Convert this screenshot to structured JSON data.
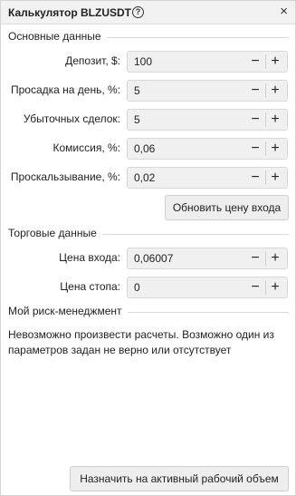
{
  "window": {
    "title": "Калькулятор BLZUSDT",
    "help_glyph": "?",
    "close_glyph": "×"
  },
  "sections": {
    "main": "Основные данные",
    "trade": "Торговые данные",
    "risk": "Мой риск-менеджмент"
  },
  "fields": {
    "deposit": {
      "label": "Депозит, $:",
      "value": "100"
    },
    "drawdown": {
      "label": "Просадка на день, %:",
      "value": "5"
    },
    "losing_trades": {
      "label": "Убыточных сделок:",
      "value": "5"
    },
    "commission": {
      "label": "Комиссия, %:",
      "value": "0,06"
    },
    "slippage": {
      "label": "Проскальзывание, %:",
      "value": "0,02"
    },
    "entry_price": {
      "label": "Цена входа:",
      "value": "0,06007"
    },
    "stop_price": {
      "label": "Цена стопа:",
      "value": "0"
    }
  },
  "stepper": {
    "minus": "−",
    "plus": "+"
  },
  "buttons": {
    "update_entry": "Обновить цену входа",
    "assign_volume": "Назначить на активный рабочий объем"
  },
  "risk_message": "Невозможно произвести расчеты. Возможно один из параметров задан не верно или отсутствует",
  "icons": [
    "help-icon",
    "close-icon",
    "minus-icon",
    "plus-icon"
  ]
}
